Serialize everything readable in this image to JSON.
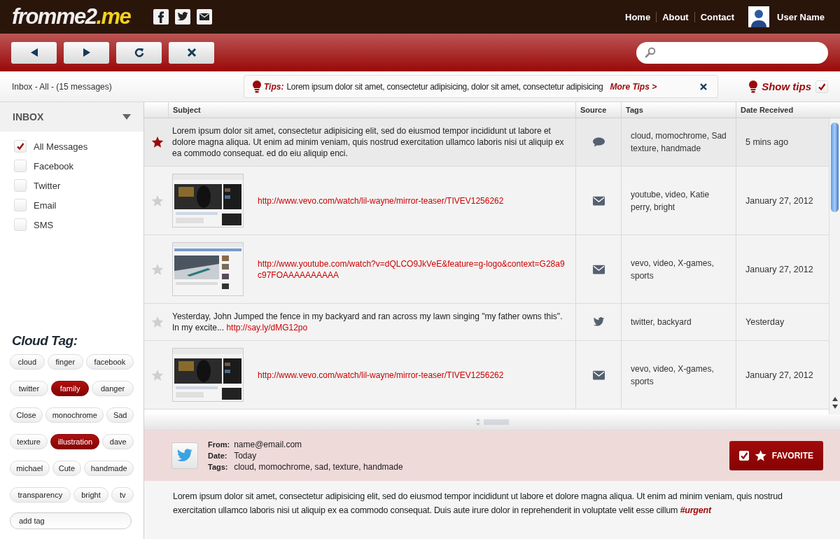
{
  "logo": {
    "main": "fromme2",
    "accent": ".me"
  },
  "nav": [
    "Home",
    "About",
    "Contact"
  ],
  "user": {
    "name": "User Name"
  },
  "breadcrumb": "Inbox - All - (15 messages)",
  "tips": {
    "label": "Tips:",
    "text": "Lorem ipsum dolor sit amet, consectetur adipisicing, dolor sit amet, consectetur adipisicing",
    "link": "More Tips >"
  },
  "show_tips": {
    "label": "Show tips",
    "checked": true
  },
  "sidebar": {
    "title": "INBOX",
    "filters": [
      {
        "label": "All Messages",
        "checked": true
      },
      {
        "label": "Facebook",
        "checked": false
      },
      {
        "label": "Twitter",
        "checked": false
      },
      {
        "label": "Email",
        "checked": false
      },
      {
        "label": "SMS",
        "checked": false
      }
    ],
    "cloud_title": "Cloud Tag:",
    "tags": [
      {
        "label": "cloud",
        "selected": false
      },
      {
        "label": "finger",
        "selected": false
      },
      {
        "label": "facebook",
        "selected": false
      },
      {
        "label": "twitter",
        "selected": false
      },
      {
        "label": "family",
        "selected": true
      },
      {
        "label": "danger",
        "selected": false
      },
      {
        "label": "Close",
        "selected": false
      },
      {
        "label": "monochrome",
        "selected": false
      },
      {
        "label": "Sad",
        "selected": false
      },
      {
        "label": "texture",
        "selected": false
      },
      {
        "label": "illustration",
        "selected": true
      },
      {
        "label": "dave",
        "selected": false
      },
      {
        "label": "michael",
        "selected": false
      },
      {
        "label": "Cute",
        "selected": false
      },
      {
        "label": "handmade",
        "selected": false
      },
      {
        "label": "transparency",
        "selected": false
      },
      {
        "label": "bright",
        "selected": false
      },
      {
        "label": "tv",
        "selected": false
      }
    ],
    "add_tag": {
      "placeholder": "add tag"
    }
  },
  "table": {
    "columns": [
      "Subject",
      "Source",
      "Tags",
      "Date Received"
    ],
    "rows": [
      {
        "starred": true,
        "subject": {
          "kind": "text",
          "text": "Lorem ipsum dolor sit amet, consectetur adipisicing elit, sed do eiusmod tempor incididunt ut labore et dolore magna aliqua. Ut enim ad minim veniam, quis nostrud exercitation ullamco laboris nisi ut aliquip ex ea commodo consequat. ed do eiu aliquip enci."
        },
        "source": {
          "kind": "chat"
        },
        "tags": "cloud, momochrome, Sad texture, handmade",
        "date": "5 mins ago"
      },
      {
        "starred": false,
        "subject": {
          "kind": "link",
          "link": "http://www.vevo.com/watch/lil-wayne/mirror-teaser/TIVEV1256262"
        },
        "source": {
          "kind": "email"
        },
        "tags": "youtube, video, Katie perry, bright",
        "date": "January 27, 2012"
      },
      {
        "starred": false,
        "subject": {
          "kind": "link",
          "link": "http://www.youtube.com/watch?v=dQLCO9JkVeE&feature=g-logo&context=G28a9c97FOAAAAAAAAAA"
        },
        "source": {
          "kind": "email"
        },
        "tags": "vevo, video, X-games, sports",
        "date": "January 27, 2012"
      },
      {
        "starred": false,
        "subject": {
          "kind": "text",
          "text": "Yesterday, John Jumped the fence in my backyard and ran across my lawn singing \"my father owns this\". In my excite...",
          "link": "http://say.ly/dMG12po"
        },
        "source": {
          "kind": "twitter"
        },
        "tags": "twitter, backyard",
        "date": "Yesterday"
      },
      {
        "starred": false,
        "subject": {
          "kind": "link",
          "link": "http://www.vevo.com/watch/lil-wayne/mirror-teaser/TIVEV1256262"
        },
        "source": {
          "kind": "email"
        },
        "tags": "vevo, video, X-games, sports",
        "date": "January 27, 2012"
      }
    ]
  },
  "detail": {
    "source": {
      "kind": "twitter"
    },
    "fields": [
      {
        "label": "From:",
        "value": "name@email.com"
      },
      {
        "label": "Date:",
        "value": "Today"
      },
      {
        "label": "Tags:",
        "value": "cloud, momochrome, sad, texture, handmade"
      }
    ],
    "favorite": {
      "label": "FAVORITE",
      "checked": true
    },
    "body": "Lorem ipsum dolor sit amet, consectetur adipisicing elit, sed do eiusmod tempor incididunt ut labore et dolore magna aliqua. Ut enim ad minim veniam, quis nostrud exercitation ullamco laboris nisi ut aliquip ex ea commodo consequat. Duis aute irure dolor in reprehenderit in voluptate velit esse cillum",
    "hashtag": "#urgent"
  }
}
